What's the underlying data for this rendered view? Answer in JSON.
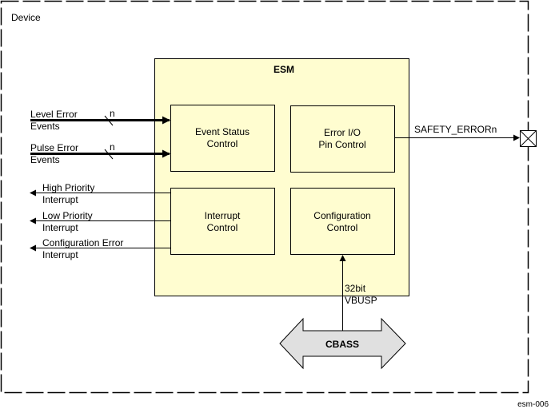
{
  "device": {
    "label": "Device"
  },
  "esm": {
    "title": "ESM"
  },
  "blocks": {
    "event_status": {
      "line1": "Event Status",
      "line2": "Control"
    },
    "error_io": {
      "line1": "Error I/O",
      "line2": "Pin Control"
    },
    "interrupt": {
      "line1": "Interrupt",
      "line2": "Control"
    },
    "configuration": {
      "line1": "Configuration",
      "line2": "Control"
    }
  },
  "inputs": [
    {
      "line1": "Level Error",
      "line2": "Events",
      "bus_width": "n"
    },
    {
      "line1": "Pulse Error",
      "line2": "Events",
      "bus_width": "n"
    }
  ],
  "outputs": [
    {
      "line1": "High Priority",
      "line2": "Interrupt"
    },
    {
      "line1": "Low Priority",
      "line2": "Interrupt"
    },
    {
      "line1": "Configuration Error",
      "line2": "Interrupt"
    }
  ],
  "safety_signal": {
    "label": "SAFETY_ERRORn"
  },
  "bus": {
    "width_label": "32bit",
    "type_label": "VBUSP",
    "interconnect": "CBASS"
  },
  "figure_id": "esm-006",
  "colors": {
    "esm_fill": "#FFFDD0",
    "cbass_fill": "#E0E0E0",
    "stroke": "#000000"
  }
}
